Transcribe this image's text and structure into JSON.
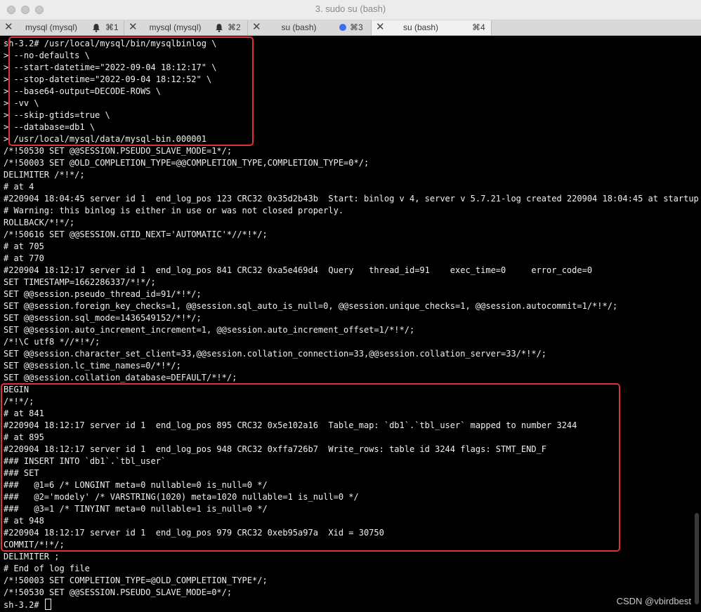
{
  "window": {
    "title": "3. sudo su (bash)"
  },
  "tabs": [
    {
      "label": "mysql (mysql)",
      "shortcut": "⌘1",
      "indicator": "bell-icon",
      "active": false
    },
    {
      "label": "mysql (mysql)",
      "shortcut": "⌘2",
      "indicator": "bell-icon",
      "active": false
    },
    {
      "label": "su (bash)",
      "shortcut": "⌘3",
      "indicator": "activity-dot-icon",
      "active": false
    },
    {
      "label": "su (bash)",
      "shortcut": "⌘4",
      "indicator": "",
      "active": true
    }
  ],
  "colors": {
    "highlight_box": "#e0303a",
    "activity_dot": "#3b6ef5",
    "terminal_bg": "#000000",
    "terminal_fg": "#f0f0f0"
  },
  "terminal": {
    "lines": [
      "sh-3.2# /usr/local/mysql/bin/mysqlbinlog \\",
      "> --no-defaults \\",
      "> --start-datetime=\"2022-09-04 18:12:17\" \\",
      "> --stop-datetime=\"2022-09-04 18:12:52\" \\",
      "> --base64-output=DECODE-ROWS \\",
      "> -vv \\",
      "> --skip-gtids=true \\",
      "> --database=db1 \\",
      "> /usr/local/mysql/data/mysql-bin.000001",
      "/*!50530 SET @@SESSION.PSEUDO_SLAVE_MODE=1*/;",
      "/*!50003 SET @OLD_COMPLETION_TYPE=@@COMPLETION_TYPE,COMPLETION_TYPE=0*/;",
      "DELIMITER /*!*/;",
      "# at 4",
      "#220904 18:04:45 server id 1  end_log_pos 123 CRC32 0x35d2b43b  Start: binlog v 4, server v 5.7.21-log created 220904 18:04:45 at startup",
      "# Warning: this binlog is either in use or was not closed properly.",
      "ROLLBACK/*!*/;",
      "/*!50616 SET @@SESSION.GTID_NEXT='AUTOMATIC'*//*!*/;",
      "# at 705",
      "# at 770",
      "#220904 18:12:17 server id 1  end_log_pos 841 CRC32 0xa5e469d4  Query   thread_id=91    exec_time=0     error_code=0",
      "SET TIMESTAMP=1662286337/*!*/;",
      "SET @@session.pseudo_thread_id=91/*!*/;",
      "SET @@session.foreign_key_checks=1, @@session.sql_auto_is_null=0, @@session.unique_checks=1, @@session.autocommit=1/*!*/;",
      "SET @@session.sql_mode=1436549152/*!*/;",
      "SET @@session.auto_increment_increment=1, @@session.auto_increment_offset=1/*!*/;",
      "/*!\\C utf8 *//*!*/;",
      "SET @@session.character_set_client=33,@@session.collation_connection=33,@@session.collation_server=33/*!*/;",
      "SET @@session.lc_time_names=0/*!*/;",
      "SET @@session.collation_database=DEFAULT/*!*/;",
      "BEGIN",
      "/*!*/;",
      "# at 841",
      "#220904 18:12:17 server id 1  end_log_pos 895 CRC32 0x5e102a16  Table_map: `db1`.`tbl_user` mapped to number 3244",
      "# at 895",
      "#220904 18:12:17 server id 1  end_log_pos 948 CRC32 0xffa726b7  Write_rows: table id 3244 flags: STMT_END_F",
      "### INSERT INTO `db1`.`tbl_user`",
      "### SET",
      "###   @1=6 /* LONGINT meta=0 nullable=0 is_null=0 */",
      "###   @2='modely' /* VARSTRING(1020) meta=1020 nullable=1 is_null=0 */",
      "###   @3=1 /* TINYINT meta=0 nullable=1 is_null=0 */",
      "# at 948",
      "#220904 18:12:17 server id 1  end_log_pos 979 CRC32 0xeb95a97a  Xid = 30750",
      "COMMIT/*!*/;",
      "DELIMITER ;",
      "# End of log file",
      "/*!50003 SET COMPLETION_TYPE=@OLD_COMPLETION_TYPE*/;",
      "/*!50530 SET @@SESSION.PSEUDO_SLAVE_MODE=0*/;"
    ],
    "prompt": "sh-3.2# "
  },
  "watermark": "CSDN @vbirdbest"
}
